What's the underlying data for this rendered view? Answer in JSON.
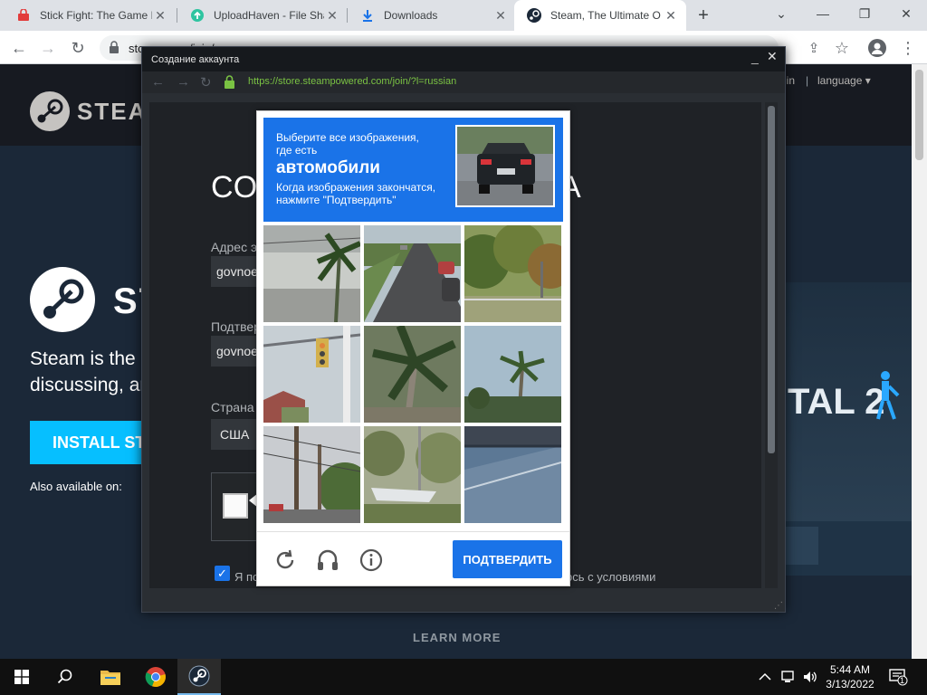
{
  "browser": {
    "tabs": [
      {
        "title": "Stick Fight: The Game I",
        "icon": "red-bag-icon"
      },
      {
        "title": "UploadHaven - File Sha",
        "icon": "cloud-upload-icon"
      },
      {
        "title": "Downloads",
        "icon": "download-icon"
      },
      {
        "title": "Steam, The Ultimate O",
        "icon": "steam-icon"
      }
    ],
    "url": "sto… … … /join/",
    "colors": {
      "tabstrip": "#dee1e6",
      "accent": "#1a73e8"
    }
  },
  "steam_page": {
    "logo_text": "STEA",
    "login": "gin",
    "separator": "|",
    "language": "language",
    "hero_word": "ST",
    "tagline_1": "Steam is the u",
    "tagline_2": "discussing, ar",
    "install_button": "INSTALL ST",
    "also_available": "Also available on:",
    "portal_text": "TAL 2",
    "learn_more": "LEARN MORE",
    "colors": {
      "background": "#1b2838",
      "install": "#06bfff"
    }
  },
  "popup": {
    "title": "Создание аккаунта",
    "url": "https://store.steampowered.com/join/?l=russian",
    "form_title_start": "СО",
    "form_title_end": "A",
    "email_label": "Адрес э",
    "email_value": "govnoe",
    "confirm_label": "Подтвер",
    "confirm_value": "govnoe",
    "country_label": "Страна",
    "country_value": "США",
    "agree_start": "Я по",
    "agree_end": "рсь с условиями",
    "agree_checked": true
  },
  "captcha": {
    "instruction": "Выберите все изображения, где есть",
    "target": "автомобили",
    "subtext": "Когда изображения закончатся, нажмите \"Подтвердить\"",
    "verify_button": "ПОДТВЕРДИТЬ",
    "tiles": [
      "road-palm-tile",
      "road-cars-tile",
      "trees-tile",
      "traffic-light-tile",
      "palm-tree-tile",
      "palm-sky-tile",
      "power-poles-tile",
      "boat-tile",
      "fence-road-tile"
    ],
    "footer_icons": [
      "reload-icon",
      "audio-icon",
      "info-icon"
    ]
  },
  "taskbar": {
    "time": "5:44 AM",
    "date": "3/13/2022",
    "notification_count": "1",
    "apps": [
      "start-icon",
      "search-icon",
      "file-explorer-icon",
      "chrome-icon",
      "steam-icon"
    ]
  }
}
